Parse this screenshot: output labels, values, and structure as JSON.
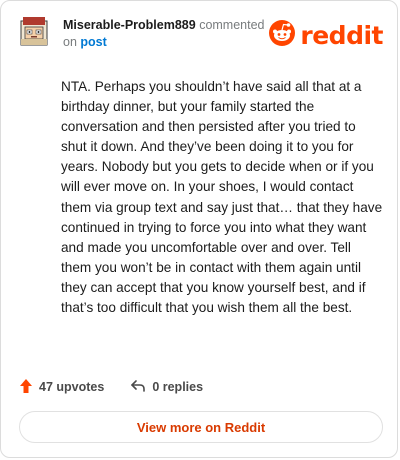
{
  "header": {
    "username": "Miserable-Problem889",
    "action": "commented",
    "on_text": "on",
    "post_link": "post",
    "logo_text": "reddit"
  },
  "comment": {
    "text": "NTA. Perhaps you shouldn’t have said all that at a birthday dinner, but your family started the conversation and then persisted after you tried to shut it down. And they’ve been doing it to you for years. Nobody but you gets to decide when or if you will ever move on. In your shoes, I would contact them via group text and say just that… that they have continued in trying to force you into what they want and made you uncomfortable over and over. Tell them you won’t be in contact with them again until they can accept that you know yourself best, and if that’s too difficult that you wish them all the best."
  },
  "footer": {
    "upvotes": "47 upvotes",
    "replies": "0 replies",
    "view_more": "View more on Reddit"
  },
  "colors": {
    "brand": "#ff4500",
    "link": "#0079d3",
    "cta": "#d93a00"
  }
}
